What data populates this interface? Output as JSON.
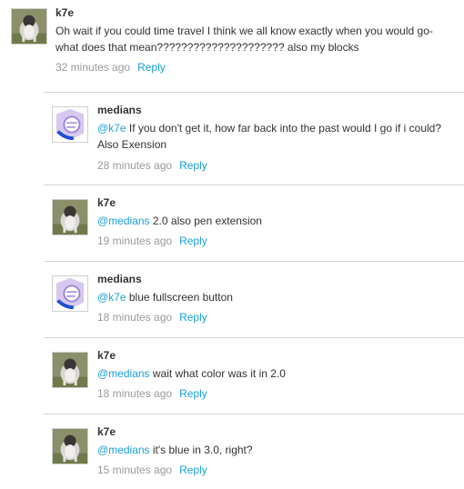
{
  "top_comment": {
    "author": "k7e",
    "text": "Oh wait if you could time travel I think we all know exactly when you would go- what does that mean????????????????????? also my blocks",
    "time": "32 minutes ago",
    "reply_label": "Reply",
    "avatar_icon": "cat-photo-avatar"
  },
  "replies": [
    {
      "author": "medians",
      "mention": "@k7e",
      "text": " If you don't get it, how far back into the past would I go if i could? Also Exension",
      "time": "28 minutes ago",
      "reply_label": "Reply",
      "avatar_icon": "purple-logo-avatar"
    },
    {
      "author": "k7e",
      "mention": "@medians",
      "text": " 2.0 also pen extension",
      "time": "19 minutes ago",
      "reply_label": "Reply",
      "avatar_icon": "cat-photo-avatar"
    },
    {
      "author": "medians",
      "mention": "@k7e",
      "text": " blue fullscreen button",
      "time": "18 minutes ago",
      "reply_label": "Reply",
      "avatar_icon": "purple-logo-avatar"
    },
    {
      "author": "k7e",
      "mention": "@medians",
      "text": " wait what color was it in 2.0",
      "time": "18 minutes ago",
      "reply_label": "Reply",
      "avatar_icon": "cat-photo-avatar"
    },
    {
      "author": "k7e",
      "mention": "@medians",
      "text": " it's blue in 3.0, right?",
      "time": "15 minutes ago",
      "reply_label": "Reply",
      "avatar_icon": "cat-photo-avatar"
    }
  ],
  "colors": {
    "link": "#1aa0d8",
    "meta": "#9a9a9a",
    "divider": "#d4d4d4"
  }
}
